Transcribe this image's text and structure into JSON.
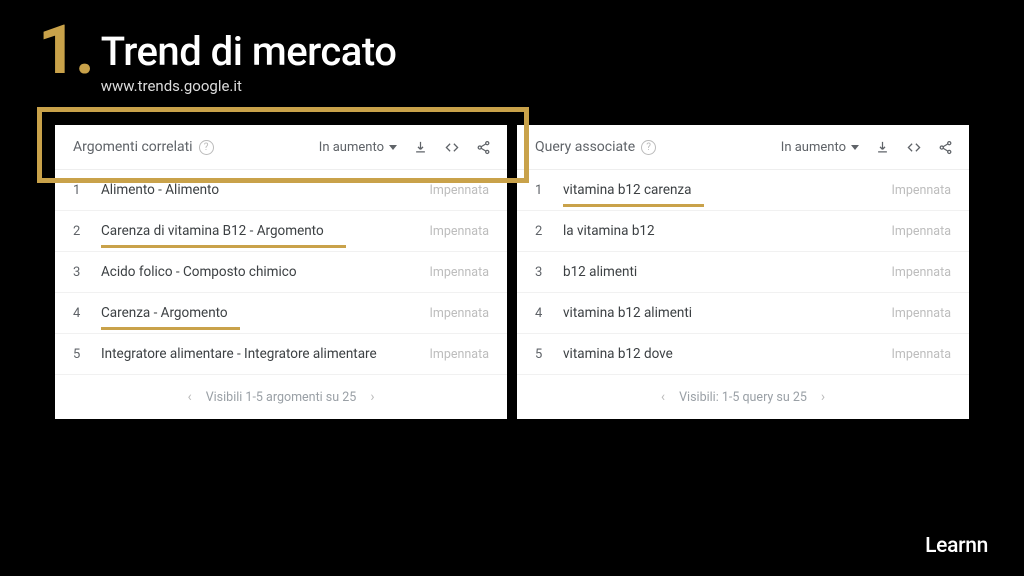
{
  "slide": {
    "number": "1",
    "dot": ".",
    "title": "Trend di mercato",
    "subtitle": "www.trends.google.it"
  },
  "brand": "Learnn",
  "leftPanel": {
    "title": "Argomenti correlati",
    "sort": "In aumento",
    "footer": "Visibili 1-5 argomenti su 25",
    "rows": [
      {
        "n": "1",
        "text": "Alimento - Alimento",
        "value": "Impennata",
        "hl": false
      },
      {
        "n": "2",
        "text": "Carenza di vitamina B12 - Argomento",
        "value": "Impennata",
        "hl": true
      },
      {
        "n": "3",
        "text": "Acido folico - Composto chimico",
        "value": "Impennata",
        "hl": false
      },
      {
        "n": "4",
        "text": "Carenza - Argomento",
        "value": "Impennata",
        "hl": true
      },
      {
        "n": "5",
        "text": "Integratore alimentare - Integratore alimentare",
        "value": "Impennata",
        "hl": false
      }
    ]
  },
  "rightPanel": {
    "title": "Query associate",
    "sort": "In aumento",
    "footer": "Visibili: 1-5 query su 25",
    "rows": [
      {
        "n": "1",
        "text": "vitamina b12 carenza",
        "value": "Impennata",
        "hl": true
      },
      {
        "n": "2",
        "text": "la vitamina b12",
        "value": "Impennata",
        "hl": false
      },
      {
        "n": "3",
        "text": "b12 alimenti",
        "value": "Impennata",
        "hl": false
      },
      {
        "n": "4",
        "text": "vitamina b12 alimenti",
        "value": "Impennata",
        "hl": false
      },
      {
        "n": "5",
        "text": "vitamina b12 dove",
        "value": "Impennata",
        "hl": false
      }
    ]
  }
}
